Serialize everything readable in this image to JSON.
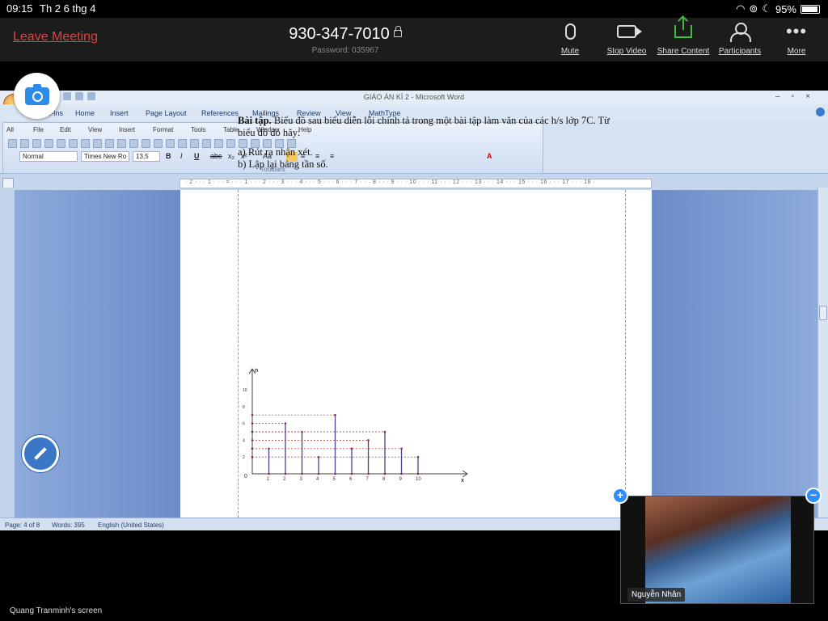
{
  "ios_status": {
    "time": "09:15",
    "date": "Th 2 6 thg 4",
    "battery": "95%"
  },
  "meeting": {
    "leave_label": "Leave Meeting",
    "meeting_id": "930-347-7010",
    "password": "Password: 035967",
    "controls": [
      {
        "label": "Mute",
        "icon": "microphone-icon"
      },
      {
        "label": "Stop Video",
        "icon": "video-camera-icon"
      },
      {
        "label": "Share Content",
        "icon": "share-icon"
      },
      {
        "label": "Participants",
        "icon": "participants-icon"
      },
      {
        "label": "More",
        "icon": "more-icon"
      }
    ]
  },
  "word": {
    "title": "GIÁO ÁN KÌ 2 - Microsoft Word",
    "ribbon_tabs": [
      "Add-Ins",
      "Home",
      "Insert",
      "Page Layout",
      "References",
      "Mailings",
      "Review",
      "View",
      "MathType"
    ],
    "menus": [
      "All",
      "File",
      "Edit",
      "View",
      "Insert",
      "Format",
      "Tools",
      "Table",
      "Window",
      "Help"
    ],
    "style_value": "Normal",
    "font_value": "Times New Ro",
    "size_value": "13,5",
    "toolbars_label": "Toolbars",
    "ruler_text": "· 2 · · · 1 · · · ⌗ · · · 1 · · · 2 · · · 3 · · · 4 · · · 5 · · · 6 · · · 7 · · · 8 · · · 9 · · · 10 · · · 11 · · · 12 · · · 13 · · · 14 · · · 15 · · · 16 · · · 17 · · · 18 ·",
    "status": {
      "page": "Page: 4 of 8",
      "words": "Words: 395",
      "language": "English (United States)"
    }
  },
  "document": {
    "exercise_title": "Bài tập.",
    "exercise_text": " Biểu đồ sau biểu diễn lỗi chính tả trong một bài tập làm văn của các h/s lớp 7C. Từ biểu đồ đó hãy:",
    "part_a": "a) Rút ra nhận xét.",
    "part_b": "b) Lập lại bảng tần số."
  },
  "chart_data": {
    "type": "bar",
    "x": [
      1,
      2,
      3,
      4,
      5,
      6,
      7,
      8,
      9,
      10
    ],
    "values": [
      3,
      6,
      5,
      2,
      7,
      3,
      4,
      5,
      3,
      2
    ],
    "x_tick_labels": [
      "1",
      "2",
      "3",
      "4",
      "5",
      "6",
      "7",
      "8",
      "9",
      "10"
    ],
    "y_ticks": [
      2,
      4,
      6,
      8,
      10
    ],
    "y_tick_labels": [
      "2",
      "4",
      "6",
      "8",
      "10"
    ],
    "origin_label": "0",
    "xlabel": "x",
    "ylabel": "n",
    "xlim": [
      0,
      12
    ],
    "ylim": [
      0,
      12
    ]
  },
  "video": {
    "participant": "Nguyễn Nhân"
  },
  "share": {
    "screen_owner": "Quang Tranminh's screen"
  }
}
